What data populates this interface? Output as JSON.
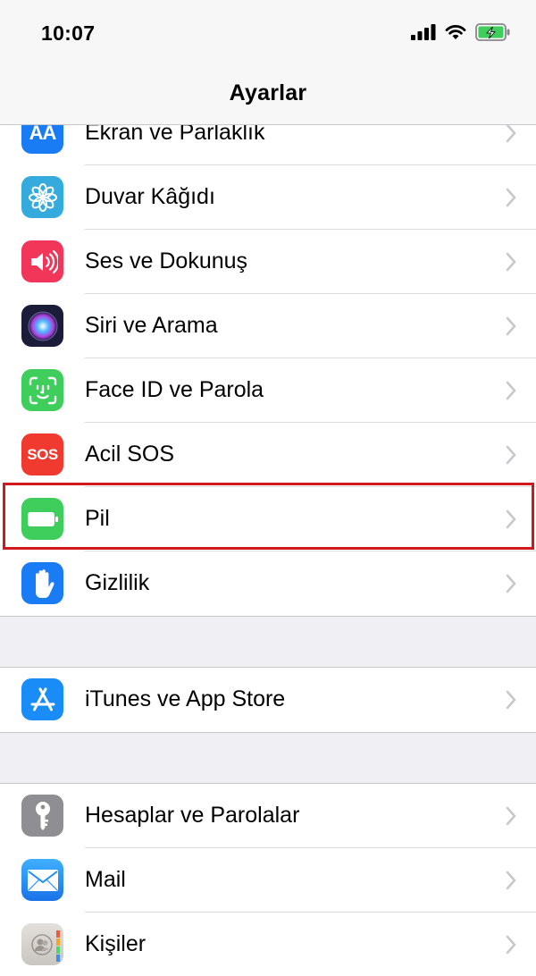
{
  "status_bar": {
    "time": "10:07",
    "icons": [
      "cellular-signal-icon",
      "wifi-icon",
      "battery-charging-icon"
    ]
  },
  "nav": {
    "title": "Ayarlar"
  },
  "groups": [
    {
      "items": [
        {
          "label": "Ekran ve Parlaklık",
          "icon": "display-brightness-icon",
          "color": "#1a7cf5",
          "glyph": "AA"
        },
        {
          "label": "Duvar Kâğıdı",
          "icon": "wallpaper-flower-icon",
          "color": "#35aadc"
        },
        {
          "label": "Ses ve Dokunuş",
          "icon": "sound-speaker-icon",
          "color": "#f2365a"
        },
        {
          "label": "Siri ve Arama",
          "icon": "siri-icon",
          "color": "#1b1b3a"
        },
        {
          "label": "Face ID ve Parola",
          "icon": "face-id-icon",
          "color": "#3fce5c"
        },
        {
          "label": "Acil SOS",
          "icon": "sos-icon",
          "color": "#f0392f",
          "glyph": "SOS"
        },
        {
          "label": "Pil",
          "icon": "battery-icon",
          "color": "#3fce5c"
        },
        {
          "label": "Gizlilik",
          "icon": "privacy-hand-icon",
          "color": "#1a7cf5"
        }
      ]
    },
    {
      "items": [
        {
          "label": "iTunes ve App Store",
          "icon": "app-store-icon",
          "color": "#1a8cf8"
        }
      ]
    },
    {
      "items": [
        {
          "label": "Hesaplar ve Parolalar",
          "icon": "key-icon",
          "color": "#8e8e93"
        },
        {
          "label": "Mail",
          "icon": "mail-icon",
          "color": "#1e8ff5"
        },
        {
          "label": "Kişiler",
          "icon": "contacts-icon",
          "color": "#d6d3cf"
        }
      ]
    }
  ],
  "highlight": {
    "target": "Pil",
    "color": "#d0191e"
  }
}
